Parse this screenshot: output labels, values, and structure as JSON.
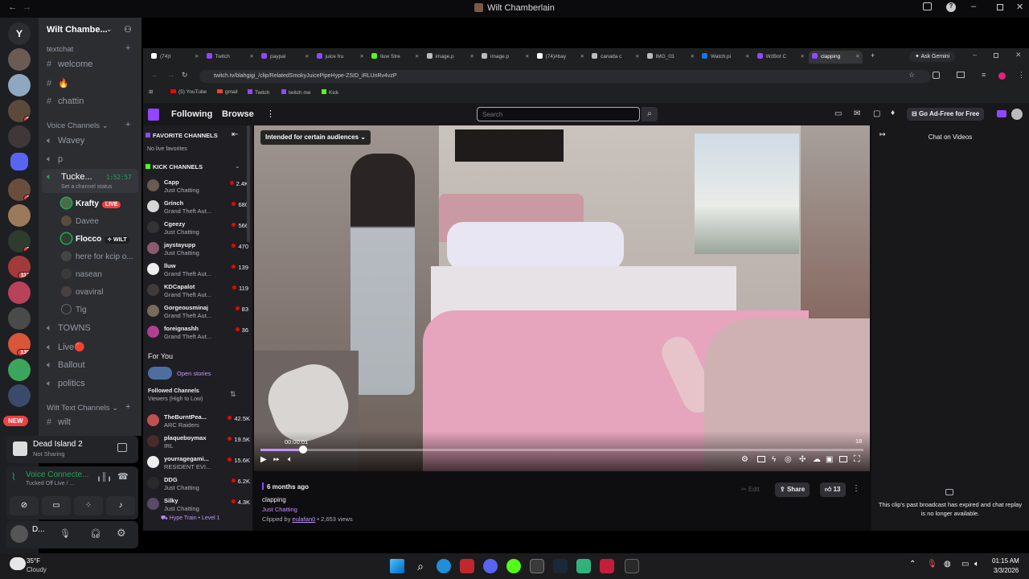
{
  "window": {
    "title": "Wilt Chamberlain"
  },
  "discord": {
    "guild_name": "Wilt Chambe...",
    "text_category": "textchat",
    "text_channels": [
      "welcome",
      "🔥",
      "chattin"
    ],
    "voice_category": "Voice Channels",
    "voice_channels": [
      "Wavey",
      "p"
    ],
    "active_voice": {
      "name": "Tucke...",
      "timer": "1:52:57",
      "status": "Set a channel status"
    },
    "voice_users": [
      {
        "name": "Krafty",
        "tag": "LIVE"
      },
      {
        "name": "Davee",
        "tag": ""
      },
      {
        "name": "Flocco",
        "tag": "WILT"
      },
      {
        "name": "here for kcip o...",
        "tag": ""
      },
      {
        "name": "nasean",
        "tag": ""
      },
      {
        "name": "ovaviral",
        "tag": ""
      },
      {
        "name": "Tig",
        "tag": ""
      }
    ],
    "more_voice": [
      "TOWNS",
      "Live🔴",
      "Ballout",
      "politics"
    ],
    "wilt_category": "Wilt Text Channels",
    "wilt_channel": "wilt",
    "rail_badges": [
      "9",
      "2",
      "1",
      "112",
      "135"
    ],
    "new_badge": "NEW",
    "server_letter": "Y",
    "game": {
      "title": "Dead Island 2",
      "status": "Not Sharing"
    },
    "voice_panel": {
      "title": "Voice Connecte...",
      "sub": "Tucked Off Live / ..."
    },
    "user": {
      "name": "D..."
    }
  },
  "browser": {
    "tabs": [
      {
        "label": "(74)t",
        "color": "#ffffff"
      },
      {
        "label": "Twitch",
        "color": "#9146ff"
      },
      {
        "label": "paypal",
        "color": "#9146ff"
      },
      {
        "label": "juice fru",
        "color": "#9146ff"
      },
      {
        "label": "lluw Stre",
        "color": "#53fc18"
      },
      {
        "label": "image.p",
        "color": "#bbbbbb"
      },
      {
        "label": "image.p",
        "color": "#bbbbbb"
      },
      {
        "label": "(74)#bay",
        "color": "#ffffff"
      },
      {
        "label": "canada c",
        "color": "#bbbbbb"
      },
      {
        "label": "IMG_03",
        "color": "#bbbbbb"
      },
      {
        "label": "Watch.pi",
        "color": "#1a73e8"
      },
      {
        "label": "WzBot C",
        "color": "#9146ff"
      },
      {
        "label": "clapping",
        "color": "#9146ff"
      }
    ],
    "ask_gemini": "Ask Gemini",
    "url": "twitch.tv/blahgigi_/clip/RelatedSmokyJuicePipeHype-ZSID_iRLUnRv4vzP",
    "bookmarks": [
      "(5) YouTube",
      "gmail",
      "Twitch",
      "twitch me",
      "Kick"
    ]
  },
  "twitch": {
    "nav": {
      "following": "Following",
      "browse": "Browse",
      "search_placeholder": "Search",
      "ad_free": "Go Ad-Free for Free"
    },
    "fav_title": "FAVORITE CHANNELS",
    "no_live": "No live favorites",
    "kick_title": "KICK CHANNELS",
    "kick_channels": [
      {
        "name": "Capp",
        "game": "Just Chatting",
        "viewers": "2.4K"
      },
      {
        "name": "Grinch",
        "game": "Grand Theft Aut...",
        "viewers": "680"
      },
      {
        "name": "Cgeezy",
        "game": "Just Chatting",
        "viewers": "566"
      },
      {
        "name": "jaystayupp",
        "game": "Just Chatting",
        "viewers": "470"
      },
      {
        "name": "lluw",
        "game": "Grand Theft Aut...",
        "viewers": "139"
      },
      {
        "name": "KDCapalot",
        "game": "Grand Theft Aut...",
        "viewers": "119"
      },
      {
        "name": "Gorgeousminaj",
        "game": "Grand Theft Aut...",
        "viewers": "83"
      },
      {
        "name": "foreignashh",
        "game": "Grand Theft Aut...",
        "viewers": "36"
      }
    ],
    "for_you": "For You",
    "open_stories": "Open stories",
    "followed_title": "Followed Channels",
    "followed_sort": "Viewers (High to Low)",
    "followed": [
      {
        "name": "TheBurntPea...",
        "game": "ARC Raiders",
        "viewers": "42.5K"
      },
      {
        "name": "plaqueboymax",
        "game": "IRL",
        "viewers": "19.5K"
      },
      {
        "name": "yourragegami...",
        "game": "RESIDENT EVI...",
        "viewers": "15.6K"
      },
      {
        "name": "DDG",
        "game": "Just Chatting",
        "viewers": "6.2K"
      },
      {
        "name": "Silky",
        "game": "Just Chatting",
        "viewers": "4.3K"
      }
    ],
    "hype_train": "Hype Train • Level 1",
    "player": {
      "audience": "Intended for certain audiences",
      "time": "00:00:01",
      "end": "18",
      "progress": 0.07
    },
    "clip": {
      "age": "6 months ago",
      "title": "clapping",
      "category": "Just Chatting",
      "clipped_by_prefix": "Clipped by ",
      "clipper": "eulafan0",
      "views": " • 2,653 views",
      "edit": "Edit",
      "share": "Share",
      "likes": "13"
    },
    "chat": {
      "title": "Chat on Videos",
      "msg": "This clip's past broadcast has expired and chat replay is no longer available."
    }
  },
  "taskbar": {
    "weather_temp": "35°F",
    "weather_desc": "Cloudy",
    "time": "01:15 AM",
    "date": "3/3/2026"
  }
}
